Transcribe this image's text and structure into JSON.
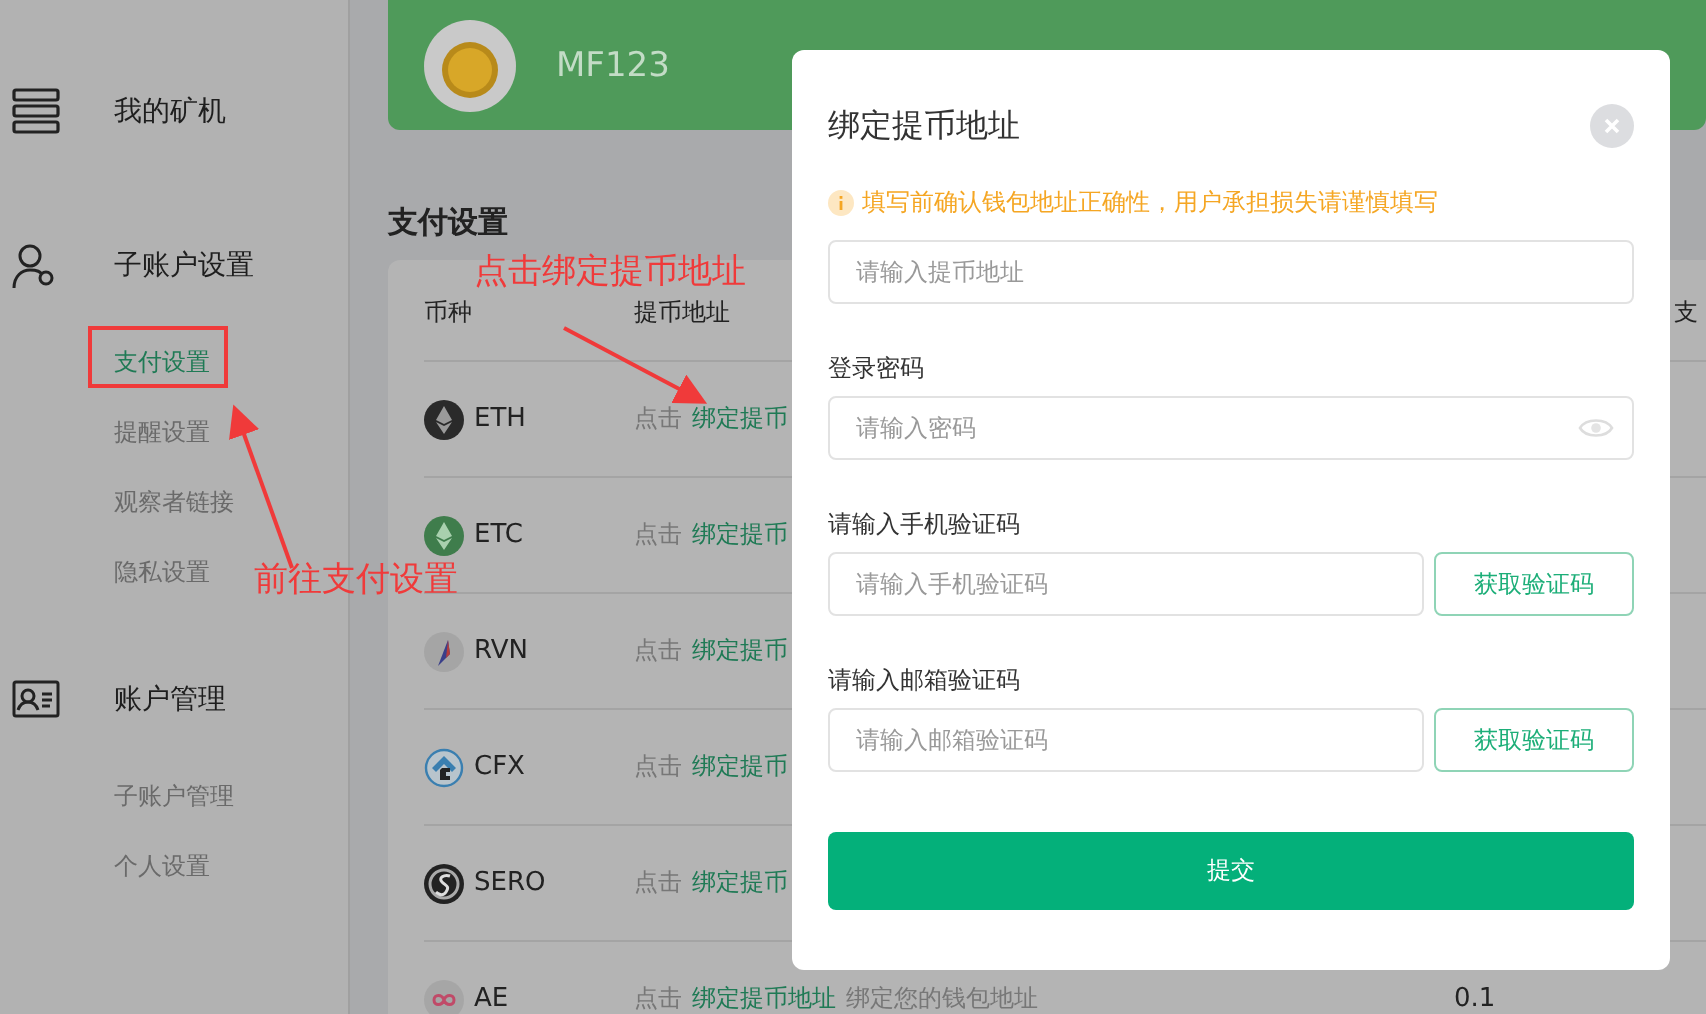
{
  "sidebar": {
    "groups": [
      {
        "label": "我的矿机",
        "kind": "server"
      },
      {
        "label": "子账户设置",
        "kind": "user-gear",
        "children": [
          {
            "label": "支付设置",
            "selected": true
          },
          {
            "label": "提醒设置",
            "selected": false
          },
          {
            "label": "观察者链接",
            "selected": false
          },
          {
            "label": "隐私设置",
            "selected": false
          }
        ]
      },
      {
        "label": "账户管理",
        "kind": "id-card",
        "children": [
          {
            "label": "子账户管理",
            "selected": false
          },
          {
            "label": "个人设置",
            "selected": false
          }
        ]
      }
    ]
  },
  "header": {
    "username": "MF123"
  },
  "section_title": "支付设置",
  "table": {
    "columns": [
      "币种",
      "提币地址",
      "支"
    ],
    "rows": [
      {
        "coin": "ETH",
        "kind": "eth",
        "prefix": "点击",
        "link": "绑定提币"
      },
      {
        "coin": "ETC",
        "kind": "etc",
        "prefix": "点击",
        "link": "绑定提币"
      },
      {
        "coin": "RVN",
        "kind": "rvn",
        "prefix": "点击",
        "link": "绑定提币"
      },
      {
        "coin": "CFX",
        "kind": "cfx",
        "prefix": "点击",
        "link": "绑定提币"
      },
      {
        "coin": "SERO",
        "kind": "sero",
        "prefix": "点击",
        "link": "绑定提币"
      },
      {
        "coin": "AE",
        "kind": "ae",
        "prefix": "点击",
        "link": "绑定提币地址",
        "note": "绑定您的钱包地址",
        "amount": "0.1"
      }
    ]
  },
  "annotations": [
    {
      "text": "点击绑定提币地址",
      "kind": "top"
    },
    {
      "text": "前往支付设置",
      "kind": "side"
    }
  ],
  "dialog": {
    "title": "绑定提币地址",
    "warning": "填写前确认钱包地址正确性，用户承担损失请谨慎填写",
    "fields": [
      {
        "kind": "text",
        "placeholder": "请输入提币地址"
      },
      {
        "kind": "password",
        "label": "登录密码",
        "placeholder": "请输入密码"
      },
      {
        "kind": "code",
        "label": "请输入手机验证码",
        "placeholder": "请输入手机验证码",
        "button": "获取验证码"
      },
      {
        "kind": "code",
        "label": "请输入邮箱验证码",
        "placeholder": "请输入邮箱验证码",
        "button": "获取验证码"
      }
    ],
    "submit": "提交"
  }
}
